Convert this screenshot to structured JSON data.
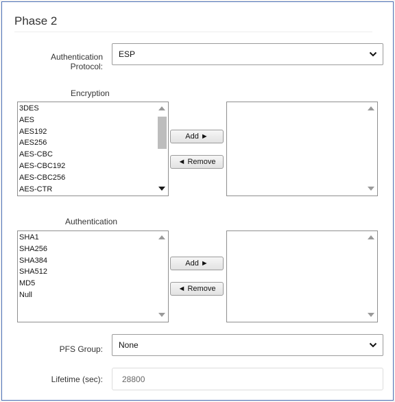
{
  "section": {
    "title": "Phase 2"
  },
  "auth_protocol": {
    "label": "Authentication Protocol:",
    "value": "ESP"
  },
  "encryption": {
    "label": "Encryption",
    "available": [
      "3DES",
      "AES",
      "AES192",
      "AES256",
      "AES-CBC",
      "AES-CBC192",
      "AES-CBC256",
      "AES-CTR"
    ],
    "selected": [],
    "add_label": "Add ►",
    "remove_label": "◄ Remove"
  },
  "authentication": {
    "label": "Authentication",
    "available": [
      "SHA1",
      "SHA256",
      "SHA384",
      "SHA512",
      "MD5",
      "Null"
    ],
    "selected": [],
    "add_label": "Add ►",
    "remove_label": "◄ Remove"
  },
  "pfs_group": {
    "label": "PFS Group:",
    "value": "None"
  },
  "lifetime": {
    "label": "Lifetime (sec):",
    "value": "28800"
  },
  "icons": {
    "dropdown": "chevron-down-icon",
    "scroll_up": "scroll-up-arrow-icon",
    "scroll_down": "scroll-down-arrow-icon"
  },
  "colors": {
    "panel_border": "#4a6fb5",
    "page_bg": "#f3f3f3"
  }
}
